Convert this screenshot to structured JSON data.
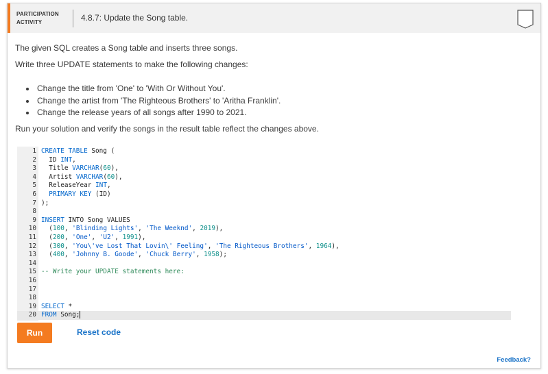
{
  "header": {
    "badge_line1": "PARTICIPATION",
    "badge_line2": "ACTIVITY",
    "title": "4.8.7: Update the Song table."
  },
  "instructions": {
    "intro": "The given SQL creates a Song table and inserts three songs.",
    "task": "Write three UPDATE statements to make the following changes:",
    "bullets": [
      "Change the title from 'One' to 'With Or Without You'.",
      "Change the artist from 'The Righteous Brothers' to 'Aritha Franklin'.",
      "Change the release years of all songs after 1990 to 2021."
    ],
    "outro": "Run your solution and verify the songs in the result table reflect the changes above."
  },
  "editor": {
    "active_line": 20,
    "lines": [
      [
        [
          "kw",
          "CREATE TABLE"
        ],
        [
          "t",
          " Song ("
        ]
      ],
      [
        [
          "t",
          "  ID "
        ],
        [
          "kw",
          "INT"
        ],
        [
          "t",
          ","
        ]
      ],
      [
        [
          "t",
          "  Title "
        ],
        [
          "kw",
          "VARCHAR"
        ],
        [
          "t",
          "("
        ],
        [
          "num",
          "60"
        ],
        [
          "t",
          "),"
        ]
      ],
      [
        [
          "t",
          "  Artist "
        ],
        [
          "kw",
          "VARCHAR"
        ],
        [
          "t",
          "("
        ],
        [
          "num",
          "60"
        ],
        [
          "t",
          "),"
        ]
      ],
      [
        [
          "t",
          "  ReleaseYear "
        ],
        [
          "kw",
          "INT"
        ],
        [
          "t",
          ","
        ]
      ],
      [
        [
          "t",
          "  "
        ],
        [
          "kw",
          "PRIMARY KEY"
        ],
        [
          "t",
          " (ID)"
        ]
      ],
      [
        [
          "t",
          ");"
        ]
      ],
      [],
      [
        [
          "kw",
          "INSERT"
        ],
        [
          "t",
          " INTO Song VALUES"
        ]
      ],
      [
        [
          "t",
          "  ("
        ],
        [
          "num",
          "100"
        ],
        [
          "t",
          ", "
        ],
        [
          "str",
          "'Blinding Lights'"
        ],
        [
          "t",
          ", "
        ],
        [
          "str",
          "'The Weeknd'"
        ],
        [
          "t",
          ", "
        ],
        [
          "num",
          "2019"
        ],
        [
          "t",
          "),"
        ]
      ],
      [
        [
          "t",
          "  ("
        ],
        [
          "num",
          "200"
        ],
        [
          "t",
          ", "
        ],
        [
          "str",
          "'One'"
        ],
        [
          "t",
          ", "
        ],
        [
          "str",
          "'U2'"
        ],
        [
          "t",
          ", "
        ],
        [
          "num",
          "1991"
        ],
        [
          "t",
          "),"
        ]
      ],
      [
        [
          "t",
          "  ("
        ],
        [
          "num",
          "300"
        ],
        [
          "t",
          ", "
        ],
        [
          "str",
          "'You\\'ve Lost That Lovin\\' Feeling'"
        ],
        [
          "t",
          ", "
        ],
        [
          "str",
          "'The Righteous Brothers'"
        ],
        [
          "t",
          ", "
        ],
        [
          "num",
          "1964"
        ],
        [
          "t",
          "),"
        ]
      ],
      [
        [
          "t",
          "  ("
        ],
        [
          "num",
          "400"
        ],
        [
          "t",
          ", "
        ],
        [
          "str",
          "'Johnny B. Goode'"
        ],
        [
          "t",
          ", "
        ],
        [
          "str",
          "'Chuck Berry'"
        ],
        [
          "t",
          ", "
        ],
        [
          "num",
          "1958"
        ],
        [
          "t",
          ");"
        ]
      ],
      [],
      [
        [
          "cmt",
          "-- Write your UPDATE statements here:"
        ]
      ],
      [],
      [],
      [],
      [
        [
          "kw",
          "SELECT"
        ],
        [
          "t",
          " *"
        ]
      ],
      [
        [
          "kw",
          "FROM"
        ],
        [
          "t",
          " Song;"
        ]
      ]
    ]
  },
  "actions": {
    "run_label": "Run",
    "reset_label": "Reset code",
    "feedback_label": "Feedback?"
  },
  "icons": {
    "bookmark": "bookmark-icon"
  },
  "colors": {
    "accent": "#f47b20",
    "link": "#1a73c8",
    "keyword": "#0066cc",
    "comment": "#2f8a5a"
  }
}
